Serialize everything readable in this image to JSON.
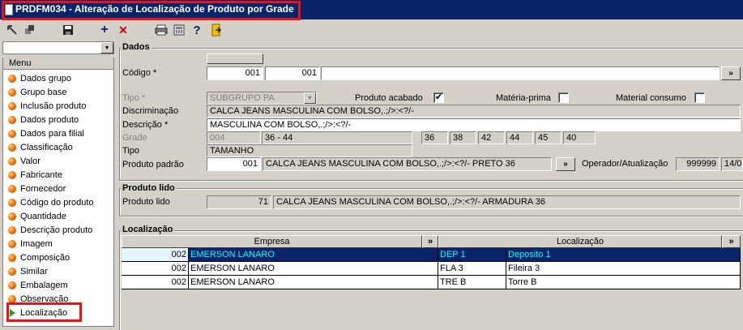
{
  "window": {
    "title": "PRDFM034 - Alteração de Localização de Produto por Grade"
  },
  "toolbar": {
    "icons": [
      "back-icon",
      "copy-icon",
      "save-icon",
      "add-icon",
      "delete-icon",
      "print-icon",
      "calculator-icon",
      "help-icon",
      "exit-icon"
    ],
    "add_glyph": "+",
    "delete_glyph": "✕",
    "help_glyph": "?"
  },
  "sidebar": {
    "combo_value": "",
    "combo_arrow": "▼",
    "header": "Menu",
    "items": [
      {
        "label": "Dados grupo"
      },
      {
        "label": "Grupo base"
      },
      {
        "label": "Inclusão produto"
      },
      {
        "label": "Dados produto"
      },
      {
        "label": "Dados para filial"
      },
      {
        "label": "Classificação"
      },
      {
        "label": "Valor"
      },
      {
        "label": "Fabricante"
      },
      {
        "label": "Fornecedor"
      },
      {
        "label": "Código do produto"
      },
      {
        "label": "Quantidade"
      },
      {
        "label": "Descrição produto"
      },
      {
        "label": "Imagem"
      },
      {
        "label": "Composição"
      },
      {
        "label": "Similar"
      },
      {
        "label": "Embalagem"
      },
      {
        "label": "Observação"
      },
      {
        "label": "Localização",
        "selected": true
      }
    ]
  },
  "dados": {
    "title": "Dados",
    "codigo_label": "Código *",
    "codigo_1": "001",
    "codigo_2": "001",
    "codigo_3": "",
    "lookup_glyph": "»",
    "tipo_label": "Tipo *",
    "tipo_value": "SUBGRUPO PA",
    "tipo_arrow": "▼",
    "produto_acabado_label": "Produto acabado",
    "produto_acabado_checked": true,
    "materia_prima_label": "Matéria-prima",
    "materia_prima_checked": false,
    "material_consumo_label": "Material consumo",
    "material_consumo_checked": false,
    "check_glyph": "✔",
    "discriminacao_label": "Discriminação",
    "discriminacao_value": "CALCA JEANS MASCULINA COM BOLSO,.;/>:<?/-",
    "descricao_label": "Descrição *",
    "descricao_value": "MASCULINA COM BOLSO,.;/>:<?/-",
    "grade_label": "Grade",
    "grade_code": "004",
    "grade_range": "36 - 44",
    "grade_sizes": [
      "36",
      "38",
      "42",
      "44",
      "45",
      "40"
    ],
    "tipo2_label": "Tipo",
    "tipo2_value": "TAMANHO",
    "produto_padrao_label": "Produto padrão",
    "produto_padrao_code": "001",
    "produto_padrao_desc": "CALCA JEANS MASCULINA COM BOLSO,.;/>:<?/- PRETO 36",
    "operador_label": "Operador/Atualização",
    "operador_value": "999999",
    "atualizacao_value": "14/0"
  },
  "produto_lido": {
    "title": "Produto lido",
    "label": "Produto lido",
    "code": "71",
    "desc": "CALCA JEANS MASCULINA COM BOLSO,.;/>:<?/- ARMADURA 36"
  },
  "localizacao": {
    "title": "Localização",
    "col_empresa": "Empresa",
    "col_localizacao": "Localização",
    "expand_glyph": "»",
    "rows": [
      {
        "cod": "002",
        "empresa": "EMERSON LANARO",
        "loc": "DEP 1",
        "desc": "Deposito 1",
        "selected": true
      },
      {
        "cod": "002",
        "empresa": "EMERSON LANARO",
        "loc": "FLA 3",
        "desc": "Fileira 3"
      },
      {
        "cod": "002",
        "empresa": "EMERSON LANARO",
        "loc": "TRE B",
        "desc": "Torre B"
      }
    ]
  },
  "colors": {
    "titlebar": "#0a246a",
    "highlight": "#e8141b",
    "selected_row_text": "#00ffff"
  }
}
